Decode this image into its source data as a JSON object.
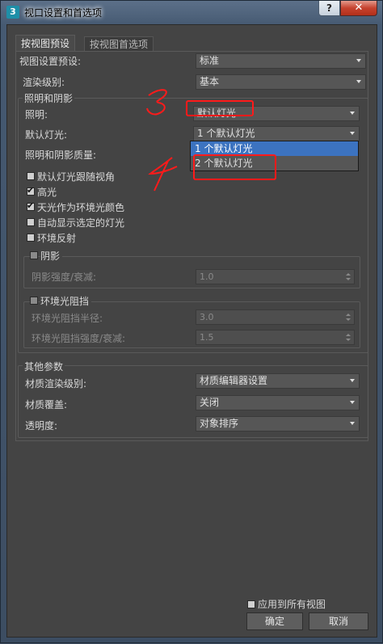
{
  "window": {
    "title": "视口设置和首选项",
    "app_icon_text": "3",
    "help_label": "?",
    "close_label": "✕"
  },
  "tabs": [
    {
      "label": "按视图预设",
      "active": true
    },
    {
      "label": "按视图首选项",
      "active": false
    }
  ],
  "form": {
    "viewport_preset": {
      "label": "视图设置预设:",
      "value": "标准"
    },
    "render_level": {
      "label": "渲染级别:",
      "value": "基本"
    },
    "lighting_shadows_header": "照明和阴影",
    "lighting": {
      "label": "照明:",
      "value": "默认灯光"
    },
    "default_lights": {
      "label": "默认灯光:",
      "value": "1 个默认灯光"
    },
    "lighting_quality": {
      "label": "照明和阴影质量:"
    },
    "checkboxes": [
      {
        "label": "默认灯光跟随视角",
        "checked": false
      },
      {
        "label": "高光",
        "checked": true
      },
      {
        "label": "天光作为环境光颜色",
        "checked": true
      },
      {
        "label": "自动显示选定的灯光",
        "checked": false
      },
      {
        "label": "环境反射",
        "checked": false
      }
    ],
    "shadows": {
      "label": "阴影",
      "checked": false,
      "intensity_label": "阴影强度/衰减:",
      "intensity_value": "1.0"
    },
    "ao": {
      "label": "环境光阻挡",
      "checked": false,
      "radius_label": "环境光阻挡半径:",
      "radius_value": "3.0",
      "amount_label": "环境光阻挡强度/衰减:",
      "amount_value": "1.5"
    },
    "other_header": "其他参数",
    "material_level": {
      "label": "材质渲染级别:",
      "value": "材质编辑器设置"
    },
    "material_override": {
      "label": "材质覆盖:",
      "value": "关闭"
    },
    "transparency": {
      "label": "透明度:",
      "value": "对象排序"
    }
  },
  "dropdown": {
    "options": [
      "1 个默认灯光",
      "2 个默认灯光"
    ],
    "selected_index": 0
  },
  "footer": {
    "apply_all": {
      "label": "应用到所有视图",
      "checked": false
    },
    "ok_label": "确定",
    "cancel_label": "取消"
  },
  "annotations": {
    "color": "#ff1a1a",
    "numbers": [
      "3",
      "4"
    ]
  }
}
